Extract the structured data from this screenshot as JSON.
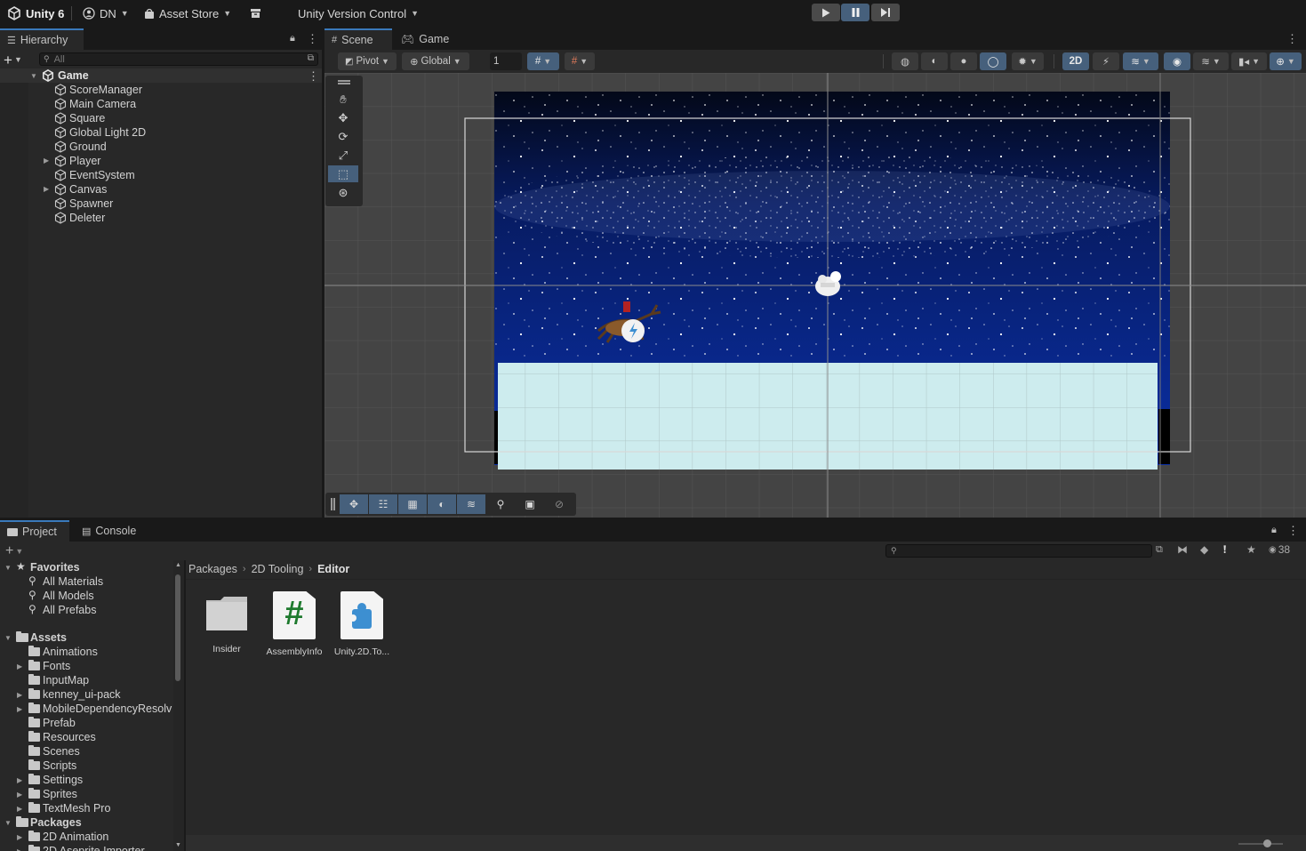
{
  "topbar": {
    "app_name": "Unity 6",
    "account": "DN",
    "asset_store": "Asset Store",
    "version_control": "Unity Version Control",
    "play_icon": "play-icon",
    "pause_icon": "pause-icon",
    "step_icon": "step-icon"
  },
  "hierarchy": {
    "tab_label": "Hierarchy",
    "search_placeholder": "All",
    "root": "Game",
    "items": [
      {
        "label": "ScoreManager",
        "expandable": false
      },
      {
        "label": "Main Camera",
        "expandable": false
      },
      {
        "label": "Square",
        "expandable": false
      },
      {
        "label": "Global Light 2D",
        "expandable": false
      },
      {
        "label": "Ground",
        "expandable": false
      },
      {
        "label": "Player",
        "expandable": true
      },
      {
        "label": "EventSystem",
        "expandable": false
      },
      {
        "label": "Canvas",
        "expandable": true
      },
      {
        "label": "Spawner",
        "expandable": false
      },
      {
        "label": "Deleter",
        "expandable": false
      }
    ]
  },
  "scene": {
    "tabs": [
      "Scene",
      "Game"
    ],
    "active_tab": "Scene",
    "pivot": "Pivot",
    "global": "Global",
    "grid_value": "1",
    "mode_2d": "2D"
  },
  "project": {
    "tabs": [
      "Project",
      "Console"
    ],
    "hidden_count": "38",
    "breadcrumb": [
      "Packages",
      "2D Tooling",
      "Editor"
    ],
    "favorites_label": "Favorites",
    "favorites": [
      "All Materials",
      "All Models",
      "All Prefabs"
    ],
    "assets_label": "Assets",
    "assets": [
      {
        "label": "Animations",
        "expandable": false
      },
      {
        "label": "Fonts",
        "expandable": true
      },
      {
        "label": "InputMap",
        "expandable": false
      },
      {
        "label": "kenney_ui-pack",
        "expandable": true
      },
      {
        "label": "MobileDependencyResolv",
        "expandable": true
      },
      {
        "label": "Prefab",
        "expandable": false
      },
      {
        "label": "Resources",
        "expandable": false
      },
      {
        "label": "Scenes",
        "expandable": false
      },
      {
        "label": "Scripts",
        "expandable": false
      },
      {
        "label": "Settings",
        "expandable": true
      },
      {
        "label": "Sprites",
        "expandable": true
      },
      {
        "label": "TextMesh Pro",
        "expandable": true
      }
    ],
    "packages_label": "Packages",
    "packages": [
      {
        "label": "2D Animation",
        "expandable": true
      },
      {
        "label": "2D Aseprite Importer",
        "expandable": true
      }
    ],
    "files": [
      {
        "label": "Insider",
        "kind": "folder"
      },
      {
        "label": "AssemblyInfo",
        "kind": "csharp-script"
      },
      {
        "label": "Unity.2D.To...",
        "kind": "assembly-definition"
      }
    ],
    "csharp_glyph": "#"
  },
  "colors": {
    "accent": "#3a79bb",
    "toggle_on": "#46607c",
    "ground": "#cdecee",
    "sky_top": "#030818",
    "sky_bottom": "#0a2fa6"
  }
}
